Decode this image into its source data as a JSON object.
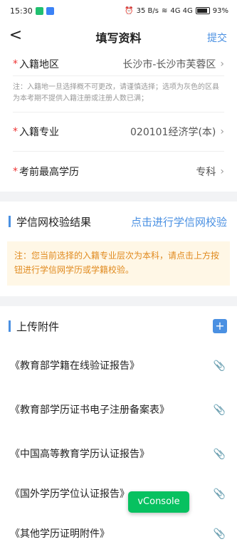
{
  "status": {
    "time": "15:30",
    "net_speed": "35 B/s",
    "signal": "4G 4G",
    "battery": "93%"
  },
  "nav": {
    "back": "<",
    "title": "填写资料",
    "submit": "提交"
  },
  "form": {
    "region": {
      "label": "入籍地区",
      "value": "长沙市-长沙市芙蓉区"
    },
    "region_note": "注：入籍地一旦选择概不可更改，请谨慎选择；选项为灰色的区县为本考期不提供入籍注册或注册人数已满；",
    "major": {
      "label": "入籍专业",
      "value": "020101经济学(本)"
    },
    "education": {
      "label": "考前最高学历",
      "value": "专科"
    }
  },
  "verify": {
    "title": "学信网校验结果",
    "link": "点击进行学信网校验",
    "warning": "注：您当前选择的入籍专业层次为本科，请点击上方按钮进行学信网学历或学籍校验。"
  },
  "attachments": {
    "title": "上传附件",
    "add_icon": "plus-icon",
    "items": [
      "《教育部学籍在线验证报告》",
      "《教育部学历证书电子注册备案表》",
      "《中国高等教育学历认证报告》",
      "《国外学历学位认证报告》",
      "《其他学历证明附件》"
    ]
  },
  "vconsole": "vConsole",
  "colors": {
    "accent": "#4a90e2",
    "required": "#e33333",
    "warning_bg": "#fff7e6",
    "warning_text": "#e08a1e",
    "vconsole": "#07c160"
  }
}
